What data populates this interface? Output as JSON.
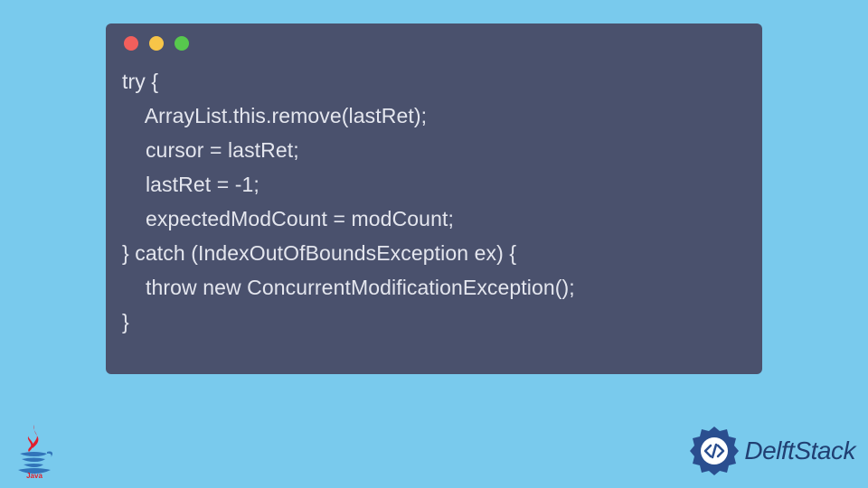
{
  "code": {
    "line1": "try {",
    "line2": "    ArrayList.this.remove(lastRet);",
    "line3": "    cursor = lastRet;",
    "line4": "    lastRet = -1;",
    "line5": "    expectedModCount = modCount;",
    "line6": "} catch (IndexOutOfBoundsException ex) {",
    "line7": "    throw new ConcurrentModificationException();",
    "line8": "}"
  },
  "logos": {
    "java_label": "Java",
    "delft_label": "DelftStack"
  },
  "colors": {
    "page_bg": "#79caed",
    "code_bg": "#4a516d",
    "code_fg": "#e4e6ee",
    "dot_red": "#f25f5c",
    "dot_yellow": "#f7c548",
    "dot_green": "#57c84d",
    "delft_blue": "#213f72",
    "java_red": "#e11e2d",
    "java_blue": "#3174b9"
  }
}
